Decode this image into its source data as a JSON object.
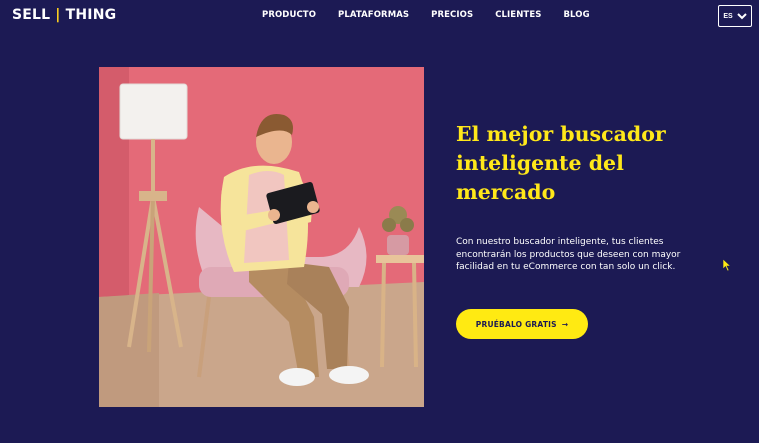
{
  "header": {
    "logo_left": "SELL",
    "logo_sep": "|",
    "logo_right": "THING",
    "nav": [
      "PRODUCTO",
      "PLATAFORMAS",
      "PRECIOS",
      "CLIENTES",
      "BLOG"
    ],
    "language": "ES"
  },
  "hero": {
    "headline_lines": [
      "El mejor buscador",
      "inteligente del",
      "mercado"
    ],
    "subtext_lines": [
      "Con nuestro buscador inteligente, tus clientes",
      "encontrarán los productos que deseen con mayor",
      "facilidad en tu eCommerce con tan solo un click."
    ],
    "cta_label": "PRUÉBALO GRATIS",
    "cta_arrow": "→"
  },
  "colors": {
    "background": "#1c1a54",
    "accent_yellow": "#ffea12",
    "headline_yellow": "#ffe81a"
  },
  "icons": {
    "language_chevron": "chevron-down-icon",
    "cta_arrow": "arrow-right-icon",
    "cursor": "mouse-cursor-icon"
  }
}
